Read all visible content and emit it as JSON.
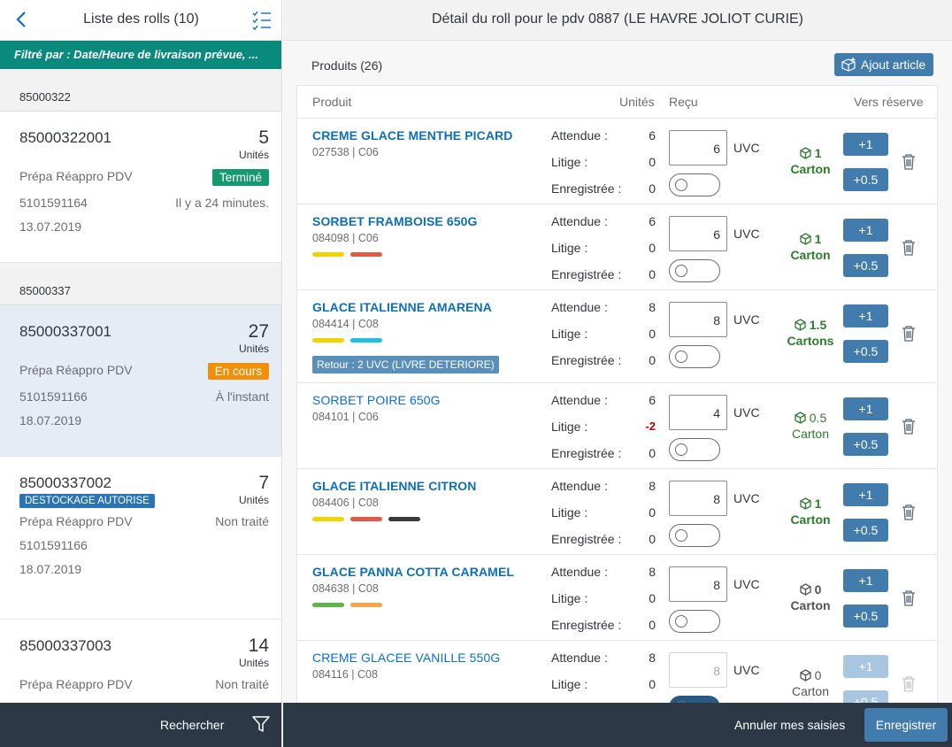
{
  "left": {
    "title": "Liste des rolls (10)",
    "filter": "Filtré par : Date/Heure de livraison prévue, ...",
    "search_label": "Rechercher",
    "groups": [
      "85000322",
      "85000337"
    ],
    "rolls": [
      {
        "id": "85000322001",
        "count": "5",
        "unit": "Unités",
        "type": "Prépa Réappro PDV",
        "status": "Terminé",
        "ref": "5101591164",
        "time": "Il y a 24 minutes.",
        "date": "13.07.2019"
      },
      {
        "id": "85000337001",
        "count": "27",
        "unit": "Unités",
        "type": "Prépa Réappro PDV",
        "status": "En cours",
        "ref": "5101591166",
        "time": "À l'instant",
        "date": "18.07.2019"
      },
      {
        "id": "85000337002",
        "count": "7",
        "unit": "Unités",
        "tag": "DESTOCKAGE AUTORISE",
        "type": "Prépa Réappro PDV",
        "status_text": "Non traité",
        "ref": "5101591166",
        "date": "18.07.2019"
      },
      {
        "id": "85000337003",
        "count": "14",
        "unit": "Unités",
        "type": "Prépa Réappro PDV",
        "status_text": "Non traité"
      }
    ]
  },
  "right": {
    "title": "Détail du roll pour le pdv 0887 (LE HAVRE JOLIOT CURIE)",
    "products_count": "Produits (26)",
    "add_label": "Ajout article",
    "columns": {
      "product": "Produit",
      "units": "Unités",
      "received": "Reçu",
      "reserve": "Vers réserve"
    },
    "row_labels": {
      "expected": "Attendue :",
      "dispute": "Litige :",
      "recorded": "Enregistrée :"
    },
    "uvc": "UVC",
    "plus_one": "+1",
    "plus_half": "+0.5",
    "products": [
      {
        "name": "CREME GLACE MENTHE PICARD",
        "code": "027538 | C06",
        "expected": "6",
        "dispute": "0",
        "recorded": "0",
        "qty": "6",
        "cartons": "1",
        "carton_label": "Carton"
      },
      {
        "name": "SORBET FRAMBOISE 650G",
        "code": "084098 | C06",
        "expected": "6",
        "dispute": "0",
        "recorded": "0",
        "qty": "6",
        "cartons": "1",
        "carton_label": "Carton"
      },
      {
        "name": "GLACE ITALIENNE AMARENA",
        "code": "084414 | C08",
        "expected": "8",
        "dispute": "0",
        "recorded": "0",
        "qty": "8",
        "cartons": "1.5",
        "carton_label": "Cartons",
        "retour": "Retour : 2 UVC (LIVRE DETERIORE)"
      },
      {
        "name": "SORBET POIRE 650G",
        "code": "084101 | C06",
        "expected": "6",
        "dispute": "-2",
        "recorded": "0",
        "qty": "4",
        "cartons": "0.5",
        "carton_label": "Carton"
      },
      {
        "name": "GLACE ITALIENNE CITRON",
        "code": "084406 | C08",
        "expected": "8",
        "dispute": "0",
        "recorded": "0",
        "qty": "8",
        "cartons": "1",
        "carton_label": "Carton"
      },
      {
        "name": "GLACE PANNA COTTA CARAMEL",
        "code": "084638 | C08",
        "expected": "8",
        "dispute": "0",
        "recorded": "0",
        "qty": "8",
        "cartons": "0",
        "carton_label": "Carton"
      },
      {
        "name": "CREME GLACEE VANILLE 550G",
        "code": "084116 | C08",
        "expected": "8",
        "dispute": "0",
        "qty": "8",
        "cartons": "0",
        "carton_label": "Carton"
      }
    ],
    "cancel_label": "Annuler mes saisies",
    "save_label": "Enregistrer"
  },
  "colors": {
    "accent": "#427cac",
    "filter_bar": "#0a8a7c",
    "footer": "#2c3845",
    "done": "#149a6f",
    "in_progress": "#f0900a",
    "carton_green": "#2b7c2b",
    "tag_yellow": "#f0d400",
    "tag_red": "#e05a47",
    "tag_cyan": "#1fc0e0",
    "tag_dark": "#3a3a3a",
    "tag_green": "#5bb547",
    "tag_orange": "#f5a64a"
  }
}
